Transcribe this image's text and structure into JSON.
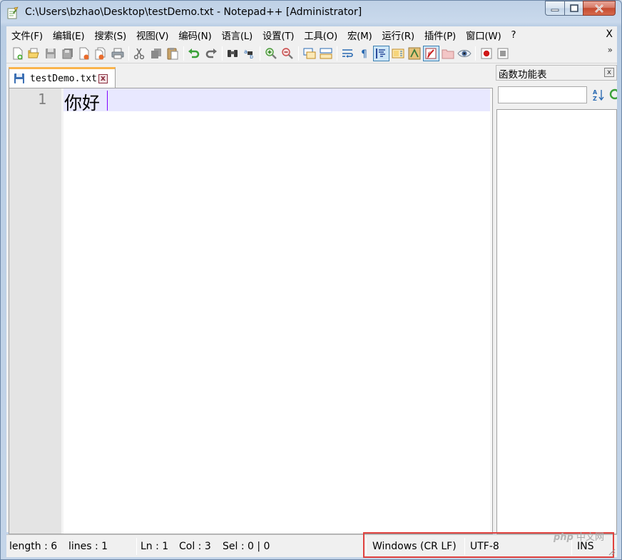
{
  "window": {
    "title": "C:\\Users\\bzhao\\Desktop\\testDemo.txt - Notepad++ [Administrator]"
  },
  "menu": {
    "items": [
      "文件(F)",
      "编辑(E)",
      "搜索(S)",
      "视图(V)",
      "编码(N)",
      "语言(L)",
      "设置(T)",
      "工具(O)",
      "宏(M)",
      "运行(R)",
      "插件(P)",
      "窗口(W)",
      "?"
    ],
    "close_label": "X"
  },
  "toolbar": {
    "more_label": "»",
    "icons": [
      "new-file-icon",
      "open-file-icon",
      "save-icon",
      "save-all-icon",
      "close-icon",
      "close-all-icon",
      "print-icon",
      "cut-icon",
      "copy-icon",
      "paste-icon",
      "undo-icon",
      "redo-icon",
      "find-icon",
      "replace-icon",
      "zoom-in-icon",
      "zoom-out-icon",
      "sync-vertical-icon",
      "sync-horizontal-icon",
      "word-wrap-icon",
      "show-all-chars-icon",
      "indent-guide-icon",
      "doc-map-icon",
      "function-list-icon",
      "folder-workspace-icon",
      "doc-switcher-icon",
      "monitoring-icon",
      "record-macro-icon",
      "stop-record-icon"
    ]
  },
  "tab": {
    "label": "testDemo.txt",
    "close_label": "x"
  },
  "editor": {
    "line_number": "1",
    "line_text": "你好"
  },
  "function_list": {
    "title": "函数功能表",
    "close_label": "x",
    "search_value": ""
  },
  "statusbar": {
    "length": "length : 6",
    "lines": "lines : 1",
    "ln": "Ln : 1",
    "col": "Col : 3",
    "sel": "Sel : 0 | 0",
    "eol": "Windows (CR LF)",
    "encoding": "UTF-8",
    "mode": "INS"
  },
  "watermark": {
    "brand": "php",
    "site": "中文网"
  },
  "colors": {
    "tab_accent": "#fab44c",
    "current_line": "#e8e8ff",
    "caret": "#8000ff",
    "highlight_box": "#e0413e"
  }
}
